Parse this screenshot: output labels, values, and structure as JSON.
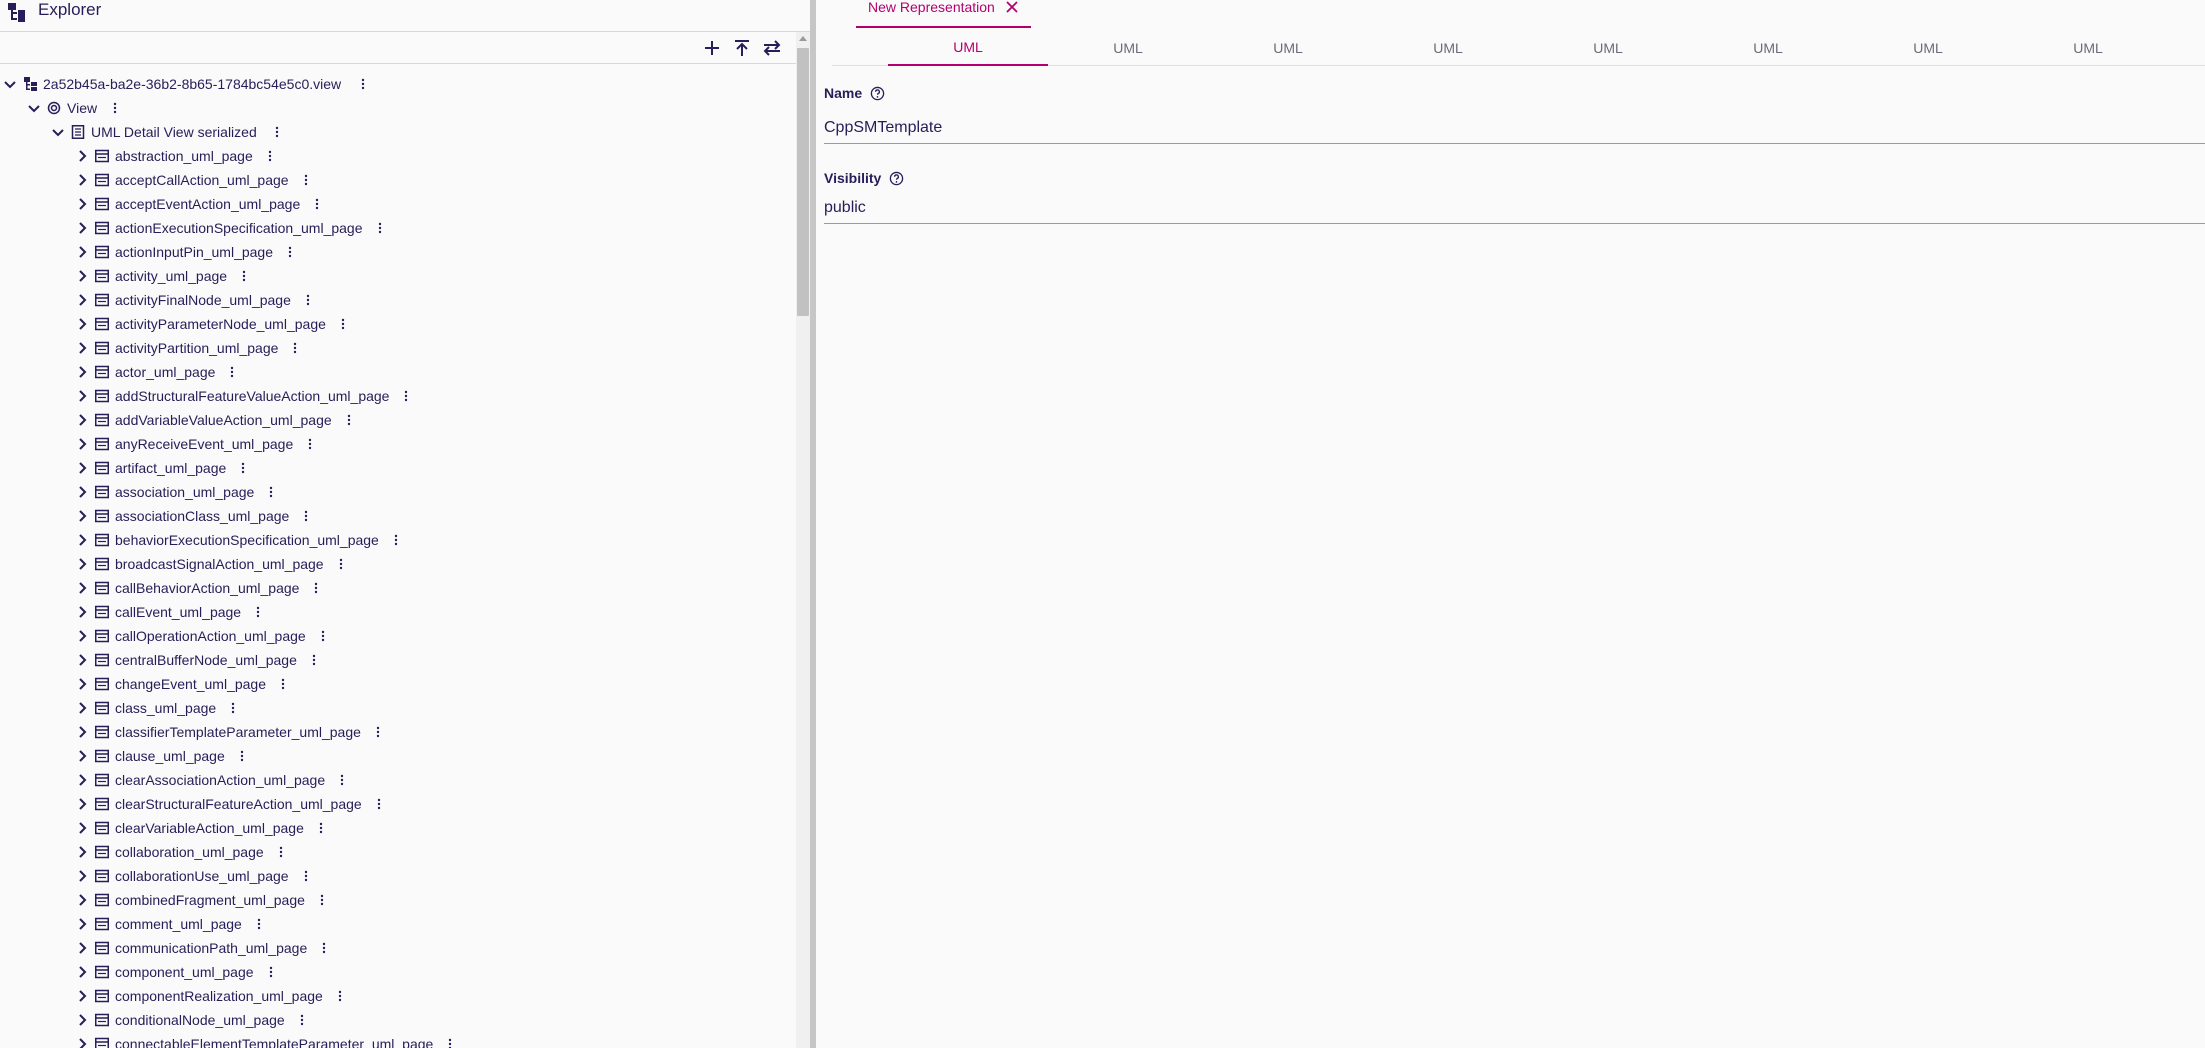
{
  "explorer": {
    "title": "Explorer",
    "toolbar": {
      "new_icon": "plus-icon",
      "upload_icon": "upload-icon",
      "sync_icon": "swap-icon"
    },
    "root": {
      "label": "2a52b45a-ba2e-36b2-8b65-1784bc54e5c0.view",
      "children_label_view": "View",
      "children_label_detail": "UML Detail View serialized"
    },
    "pages": [
      "abstraction_uml_page",
      "acceptCallAction_uml_page",
      "acceptEventAction_uml_page",
      "actionExecutionSpecification_uml_page",
      "actionInputPin_uml_page",
      "activity_uml_page",
      "activityFinalNode_uml_page",
      "activityParameterNode_uml_page",
      "activityPartition_uml_page",
      "actor_uml_page",
      "addStructuralFeatureValueAction_uml_page",
      "addVariableValueAction_uml_page",
      "anyReceiveEvent_uml_page",
      "artifact_uml_page",
      "association_uml_page",
      "associationClass_uml_page",
      "behaviorExecutionSpecification_uml_page",
      "broadcastSignalAction_uml_page",
      "callBehaviorAction_uml_page",
      "callEvent_uml_page",
      "callOperationAction_uml_page",
      "centralBufferNode_uml_page",
      "changeEvent_uml_page",
      "class_uml_page",
      "classifierTemplateParameter_uml_page",
      "clause_uml_page",
      "clearAssociationAction_uml_page",
      "clearStructuralFeatureAction_uml_page",
      "clearVariableAction_uml_page",
      "collaboration_uml_page",
      "collaborationUse_uml_page",
      "combinedFragment_uml_page",
      "comment_uml_page",
      "communicationPath_uml_page",
      "component_uml_page",
      "componentRealization_uml_page",
      "conditionalNode_uml_page",
      "connectableElementTemplateParameter_uml_page"
    ]
  },
  "editor": {
    "representation_tab": "New Representation",
    "uml_tabs": [
      "UML",
      "UML",
      "UML",
      "UML",
      "UML",
      "UML",
      "UML",
      "UML",
      "UML"
    ],
    "active_tab_index": 0,
    "fields": {
      "name_label": "Name",
      "name_value": "CppSMTemplate",
      "visibility_label": "Visibility",
      "visibility_value": "public"
    }
  },
  "colors": {
    "accent": "#b4006e",
    "text": "#261e58",
    "tab_inactive": "#6b6b7a",
    "background": "#fafafa"
  }
}
